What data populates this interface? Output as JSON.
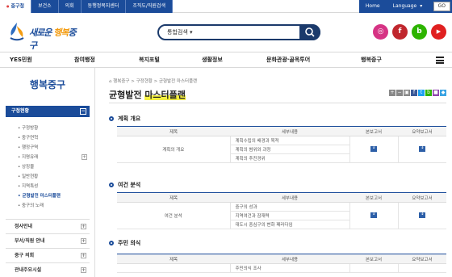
{
  "topbar": {
    "links": [
      "중구청",
      "보건소",
      "의회",
      "동행정복지센터",
      "조직도/직원검색"
    ],
    "home": "Home",
    "language": "Language",
    "go": "GO"
  },
  "header": {
    "logo_text_a": "새로운",
    "logo_text_b": " 행복",
    "logo_text_c": "중구",
    "search_select": "통합검색"
  },
  "social_colors": {
    "instagram": "#d63384",
    "facebook": "#c0262d",
    "blog": "#2db400",
    "youtube": "#e02020"
  },
  "social_icons": {
    "instagram": "◎",
    "facebook": "f",
    "blog": "b",
    "youtube": "▶"
  },
  "nav": [
    "YES민원",
    "참여행정",
    "복지포털",
    "생활정보",
    "문화관광·골목투어",
    "행복중구"
  ],
  "sidebar": {
    "title": "행복중구",
    "section_head": "구정현황",
    "minus": "−",
    "plus": "+",
    "subitems": [
      "구정방향",
      "중구연혁",
      "행정구역",
      "지명유래",
      "상징물",
      "일반현황",
      "지역특성",
      "균형발전 마스터플랜",
      "중구의 노래"
    ],
    "sections": [
      "정사안내",
      "부서/직원 안내",
      "중구 의회",
      "관내주요시설"
    ]
  },
  "content": {
    "breadcrumb": "행복중구 > 구정현황 > 균형발전 마스터플랜",
    "title_a": "균형발전 ",
    "title_b": "마스터플랜",
    "tool_icons": [
      "+",
      "−",
      "▣",
      "f",
      "t",
      "b",
      "■",
      "◆"
    ],
    "headers": [
      "제목",
      "세부내용",
      "본보고서",
      "요약보고서"
    ],
    "sections": [
      {
        "title": "계획 개요",
        "category": "계획의 개요",
        "items": [
          "계획수립의 배경과 목적",
          "계획의 범위와 과정",
          "계획의 추진경위"
        ]
      },
      {
        "title": "여건 분석",
        "category": "여건 분석",
        "items": [
          "중구의 성과",
          "지역여건과 잠재력",
          "대도시 중심구의 변화 패러다임"
        ]
      },
      {
        "title": "주민 의식",
        "category": "",
        "items": [
          "주민의식 조사"
        ]
      }
    ]
  }
}
